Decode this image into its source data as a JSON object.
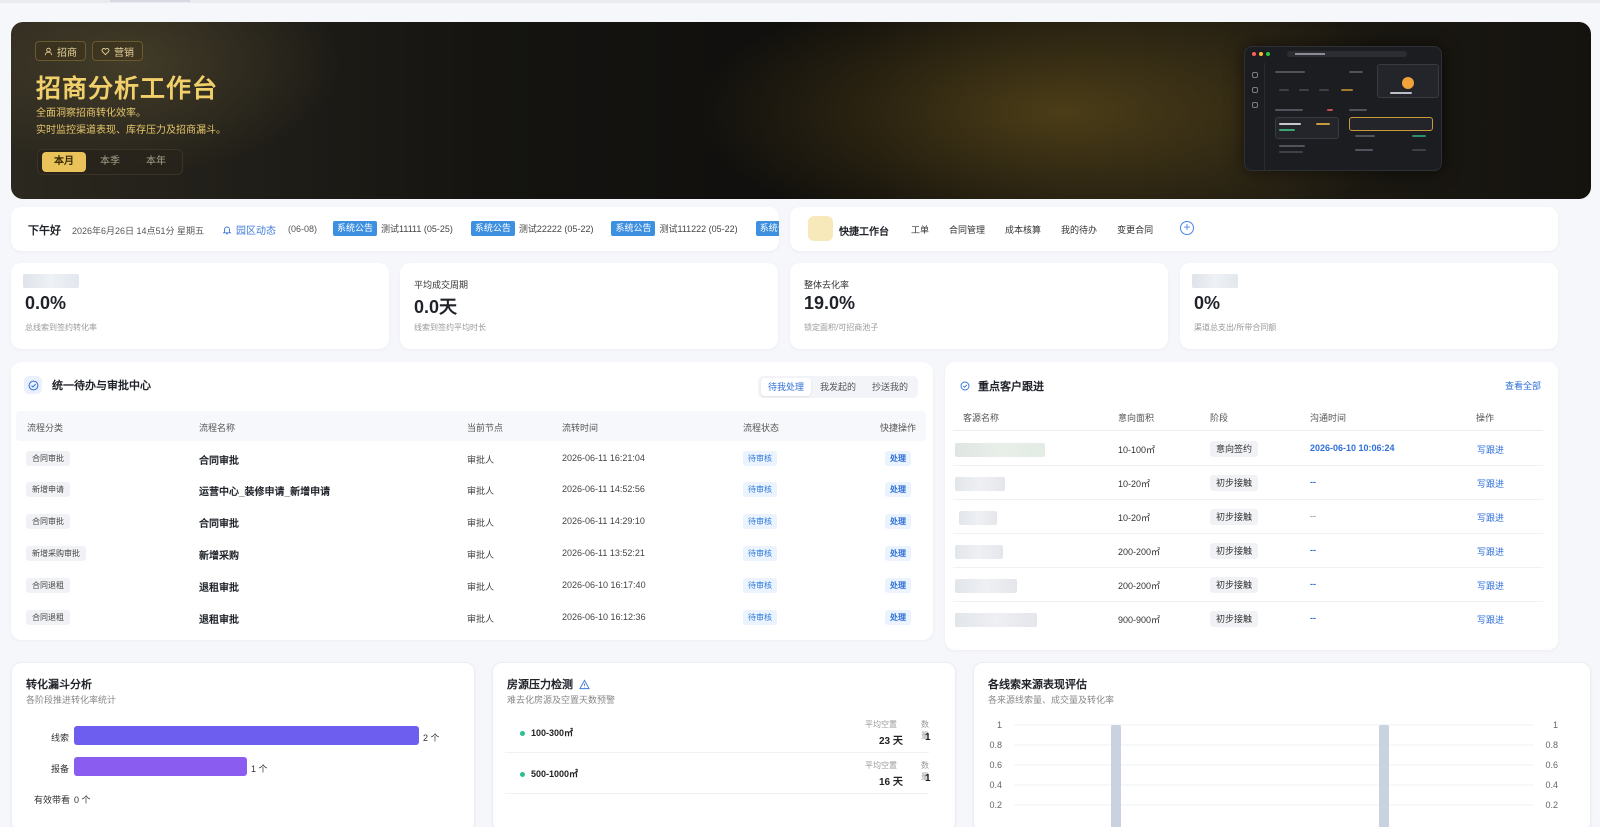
{
  "hero": {
    "tags": [
      {
        "label": "招商",
        "icon": "user-icon"
      },
      {
        "label": "营销",
        "icon": "heart-icon"
      }
    ],
    "title": "招商分析工作台",
    "subtitle1": "全面洞察招商转化效率。",
    "subtitle2": "实时监控渠道表现、库存压力及招商漏斗。",
    "periods": [
      "本月",
      "本季",
      "本年"
    ],
    "active_period": "本月",
    "accent": "#f1cf6b"
  },
  "greeting": {
    "hello": "下午好",
    "datetime": "2026年6月26日 14点51分 星期五",
    "park_label": "园区动态",
    "park_date": "(06-08)",
    "notices": [
      {
        "badge": "系统公告",
        "text": "测试11111 (05-25)"
      },
      {
        "badge": "系统公告",
        "text": "测试22222 (05-22)"
      },
      {
        "badge": "系统公告",
        "text": "测试111222 (05-22)"
      },
      {
        "badge": "系统公告",
        "text": ""
      }
    ]
  },
  "quick": {
    "title": "快捷工作台",
    "links": [
      "工单",
      "合同管理",
      "成本核算",
      "我的待办",
      "变更合同"
    ],
    "add_label": "+"
  },
  "kpis": [
    {
      "label": "",
      "value": "0.0%",
      "desc": "总线索到签约转化率",
      "blurred_label": true
    },
    {
      "label": "平均成交周期",
      "value": "0.0天",
      "desc": "线索到签约平均时长",
      "blurred_label": false
    },
    {
      "label": "整体去化率",
      "value": "19.0%",
      "desc": "锁定面积/可招商池子",
      "blurred_label": false
    },
    {
      "label": "",
      "value": "0%",
      "desc": "渠道总支出/所带合同额",
      "blurred_label": true
    }
  ],
  "approval": {
    "title": "统一待办与审批中心",
    "tabs": [
      "待我处理",
      "我发起的",
      "抄送我的"
    ],
    "active_tab": "待我处理",
    "columns": [
      "流程分类",
      "流程名称",
      "当前节点",
      "流转时间",
      "流程状态",
      "快捷操作"
    ],
    "rows": [
      {
        "category": "合同审批",
        "name": "合同审批",
        "node": "审批人",
        "time": "2026-06-11 16:21:04",
        "status": "待审核",
        "action": "处理"
      },
      {
        "category": "新增申请",
        "name": "运营中心_装修申请_新增申请",
        "node": "审批人",
        "time": "2026-06-11 14:52:56",
        "status": "待审核",
        "action": "处理"
      },
      {
        "category": "合同审批",
        "name": "合同审批",
        "node": "审批人",
        "time": "2026-06-11 14:29:10",
        "status": "待审核",
        "action": "处理"
      },
      {
        "category": "新增采购审批",
        "name": "新增采购",
        "node": "审批人",
        "time": "2026-06-11 13:52:21",
        "status": "待审核",
        "action": "处理"
      },
      {
        "category": "合同退租",
        "name": "退租审批",
        "node": "审批人",
        "time": "2026-06-10 16:17:40",
        "status": "待审核",
        "action": "处理"
      },
      {
        "category": "合同退租",
        "name": "退租审批",
        "node": "审批人",
        "time": "2026-06-10 16:12:36",
        "status": "待审核",
        "action": "处理"
      }
    ]
  },
  "customers": {
    "title": "重点客户跟进",
    "view_all": "查看全部",
    "columns": [
      "客源名称",
      "意向面积",
      "阶段",
      "沟通时间",
      "操作"
    ],
    "rows": [
      {
        "area": "10-100㎡",
        "stage": "意向签约",
        "contact": "2026-06-10 10:06:24",
        "action": "写跟进"
      },
      {
        "area": "10-20㎡",
        "stage": "初步接触",
        "contact": "--",
        "action": "写跟进"
      },
      {
        "area": "10-20㎡",
        "stage": "初步接触",
        "contact": "--",
        "action": "写跟进"
      },
      {
        "area": "200-200㎡",
        "stage": "初步接触",
        "contact": "--",
        "action": "写跟进"
      },
      {
        "area": "200-200㎡",
        "stage": "初步接触",
        "contact": "--",
        "action": "写跟进"
      },
      {
        "area": "900-900㎡",
        "stage": "初步接触",
        "contact": "--",
        "action": "写跟进"
      }
    ]
  },
  "funnel": {
    "title": "转化漏斗分析",
    "subtitle": "各阶段推进转化率统计",
    "stages": [
      {
        "label": "线索",
        "value": 2,
        "text": "2 个",
        "color": "#6d5ef0"
      },
      {
        "label": "报备",
        "value": 1,
        "text": "1 个",
        "color": "#8b5cf0"
      },
      {
        "label": "有效带看",
        "value": 0,
        "text": "0 个",
        "color": "#a06ef2"
      }
    ]
  },
  "pressure": {
    "title": "房源压力检测",
    "subtitle": "难去化房源及空置天数预警",
    "col_days": "平均空置",
    "col_count": "数量",
    "rows": [
      {
        "range": "100-300㎡",
        "days": "23 天",
        "count": "1"
      },
      {
        "range": "500-1000㎡",
        "days": "16 天",
        "count": "1"
      }
    ]
  },
  "chart_data": {
    "type": "bar",
    "title": "各线索来源表现评估",
    "subtitle": "各来源线索量、成交量及转化率",
    "yticks_left": [
      "1",
      "0.8",
      "0.6",
      "0.4",
      "0.2"
    ],
    "yticks_right": [
      "1",
      "0.8",
      "0.6",
      "0.4",
      "0.2"
    ],
    "ylim": [
      0,
      1
    ],
    "series": [
      {
        "values": [
          1,
          1
        ],
        "color": "#c9d3e0"
      }
    ],
    "grid": true
  }
}
